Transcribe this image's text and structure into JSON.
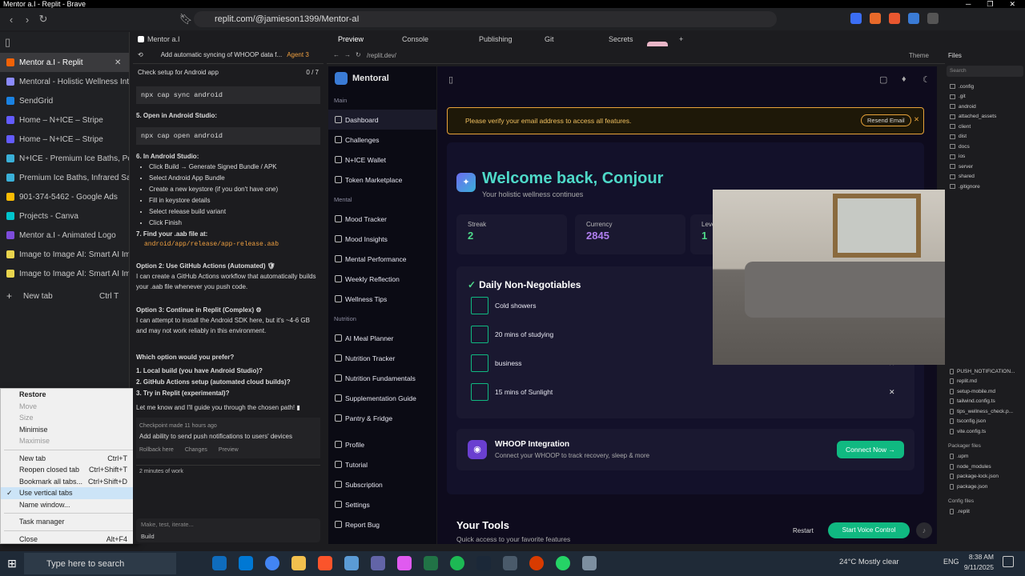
{
  "window": {
    "title": "Mentor a.I - Replit - Brave"
  },
  "browser": {
    "url": "replit.com/@jamieson1399/Mentor-aI"
  },
  "vtabs": [
    {
      "label": "Mentor a.I - Replit",
      "color": "#f26207",
      "active": true
    },
    {
      "label": "Mentoral - Holistic Wellness Intellig",
      "color": "#8b8bff"
    },
    {
      "label": "SendGrid",
      "color": "#1a82e2"
    },
    {
      "label": "Home – N+ICE – Stripe",
      "color": "#635bff"
    },
    {
      "label": "Home – N+ICE – Stripe",
      "color": "#635bff"
    },
    {
      "label": "N+ICE - Premium Ice Baths, Portabl",
      "color": "#3ab0d8"
    },
    {
      "label": "Premium Ice Baths, Infrared Sauna",
      "color": "#3ab0d8"
    },
    {
      "label": "901-374-5462 - Google Ads",
      "color": "#fbbc04"
    },
    {
      "label": "Projects - Canva",
      "color": "#00c4cc"
    },
    {
      "label": "Mentor a.I - Animated Logo",
      "color": "#7d4cdb"
    },
    {
      "label": "Image to Image AI: Smart AI Image",
      "color": "#e8d44d"
    },
    {
      "label": "Image to Image AI: Smart AI Image",
      "color": "#e8d44d"
    }
  ],
  "new_tab": {
    "label": "New tab",
    "shortcut": "Ctrl T"
  },
  "ctx_menu": [
    {
      "label": "Restore",
      "shortcut": "",
      "disabled": false,
      "bold": true
    },
    {
      "label": "Move",
      "shortcut": "",
      "disabled": true
    },
    {
      "label": "Size",
      "shortcut": "",
      "disabled": true
    },
    {
      "label": "Minimise",
      "shortcut": "",
      "disabled": false
    },
    {
      "label": "Maximise",
      "shortcut": "",
      "disabled": true
    },
    {
      "sep": true
    },
    {
      "label": "New tab",
      "shortcut": "Ctrl+T"
    },
    {
      "label": "Reopen closed tab",
      "shortcut": "Ctrl+Shift+T"
    },
    {
      "label": "Bookmark all tabs...",
      "shortcut": "Ctrl+Shift+D"
    },
    {
      "label": "Use vertical tabs",
      "shortcut": "",
      "checked": true
    },
    {
      "label": "Name window...",
      "shortcut": ""
    },
    {
      "sep": true
    },
    {
      "label": "Task manager",
      "shortcut": ""
    },
    {
      "sep": true
    },
    {
      "label": "Close",
      "shortcut": "Alt+F4"
    }
  ],
  "replit_tabs": {
    "project": "Mentor a.I",
    "preview": "Preview",
    "console": "Console",
    "publishing": "Publishing",
    "git": "Git",
    "secrets": "Secrets"
  },
  "agent": {
    "thread_title": "Add automatic syncing of WHOOP data f...",
    "agent_badge": "Agent 3",
    "task": "Check setup for Android app",
    "task_count": "0 / 7",
    "code1": "npx cap sync android",
    "step5": "5. Open in Android Studio:",
    "code2": "npx cap open android",
    "step6": "6. In Android Studio:",
    "bullets": [
      "Click Build → Generate Signed Bundle / APK",
      "Select Android App Bundle",
      "Create a new keystore (if you don't have one)",
      "Fill in keystore details",
      "Select release build variant",
      "Click Finish"
    ],
    "step7": "7. Find your .aab file at:",
    "aab_path": "android/app/release/app-release.aab",
    "opt2_title": "Option 2: Use GitHub Actions (Automated) 🛡",
    "opt2_body": "I can create a GitHub Actions workflow that automatically builds your .aab file whenever you push code.",
    "opt3_title": "Option 3: Continue in Replit (Complex) ⚙",
    "opt3_body": "I can attempt to install the Android SDK here, but it's ~4-6 GB and may not work reliably in this environment.",
    "question": "Which option would you prefer?",
    "choices": [
      "1. Local build (you have Android Studio)?",
      "2. GitHub Actions setup (automated cloud builds)?",
      "3. Try in Replit (experimental)?"
    ],
    "closing": "Let me know and I'll guide you through the chosen path! ▮",
    "checkpoint": "Checkpoint made 11 hours ago",
    "checkpoint_msg": "Add ability to send push notifications to users' devices",
    "rollback": "Rollback here",
    "changes": "Changes",
    "preview": "Preview",
    "work": "2 minutes of work",
    "input_placeholder": "Make, test, iterate...",
    "build": "Build"
  },
  "preview_bar": {
    "url": "/replit.dev/",
    "theme": "Theme"
  },
  "app": {
    "brand": "Mentoral",
    "sections": [
      {
        "title": "Main",
        "items": [
          "Dashboard",
          "Challenges",
          "N+ICE Wallet",
          "Token Marketplace"
        ]
      },
      {
        "title": "Mental",
        "items": [
          "Mood Tracker",
          "Mood Insights",
          "Mental Performance",
          "Weekly Reflection",
          "Wellness Tips"
        ]
      },
      {
        "title": "Nutrition",
        "items": [
          "AI Meal Planner",
          "Nutrition Tracker",
          "Nutrition Fundamentals",
          "Supplementation Guide",
          "Pantry & Fridge"
        ]
      },
      {
        "title": "",
        "items": [
          "Profile",
          "Tutorial",
          "Subscription",
          "Settings",
          "Report Bug"
        ]
      }
    ],
    "verify": {
      "text": "Please verify your email address to access all features.",
      "button": "Resend Email"
    },
    "welcome": {
      "title": "Welcome back, Conjour",
      "subtitle": "Your holistic wellness continues"
    },
    "stats": [
      {
        "label": "Streak",
        "value": "2"
      },
      {
        "label": "Currency",
        "value": "2845"
      },
      {
        "label": "Leve",
        "value": "1"
      }
    ],
    "nonneg": {
      "title": "Daily Non-Negotiables",
      "items": [
        "Cold showers",
        "20 mins of studying",
        "business",
        "15 mins of Sunlight"
      ]
    },
    "whoop": {
      "title": "WHOOP Integration",
      "subtitle": "Connect your WHOOP to track recovery, sleep & more",
      "button": "Connect Now →"
    },
    "tools": {
      "title": "Your Tools",
      "subtitle": "Quick access to your favorite features"
    },
    "voice": {
      "button": "Start Voice Control",
      "restart": "Restart"
    }
  },
  "files": {
    "header": "Files",
    "search": "Search",
    "items": [
      ".config",
      ".git",
      "android",
      "attached_assets",
      "client",
      "dist",
      "docs",
      "ios",
      "server",
      "shared",
      ".gitignore"
    ],
    "items2": [
      "PUSH_NOTIFICATION...",
      "replit.md",
      "setup-mobile.md",
      "tailwind.config.ts",
      "tips_wellness_check.p...",
      "tsconfig.json",
      "vite.config.ts"
    ],
    "pkg_header": "Packager files",
    "pkg": [
      ".upm",
      "node_modules",
      "package-lock.json",
      "package.json"
    ],
    "cfg_header": "Config files",
    "cfg": [
      ".replit"
    ]
  },
  "taskbar": {
    "search": "Type here to search",
    "weather": "24°C  Mostly clear",
    "lang": "ENG",
    "time": "8:38 AM",
    "date": "9/11/2025"
  }
}
